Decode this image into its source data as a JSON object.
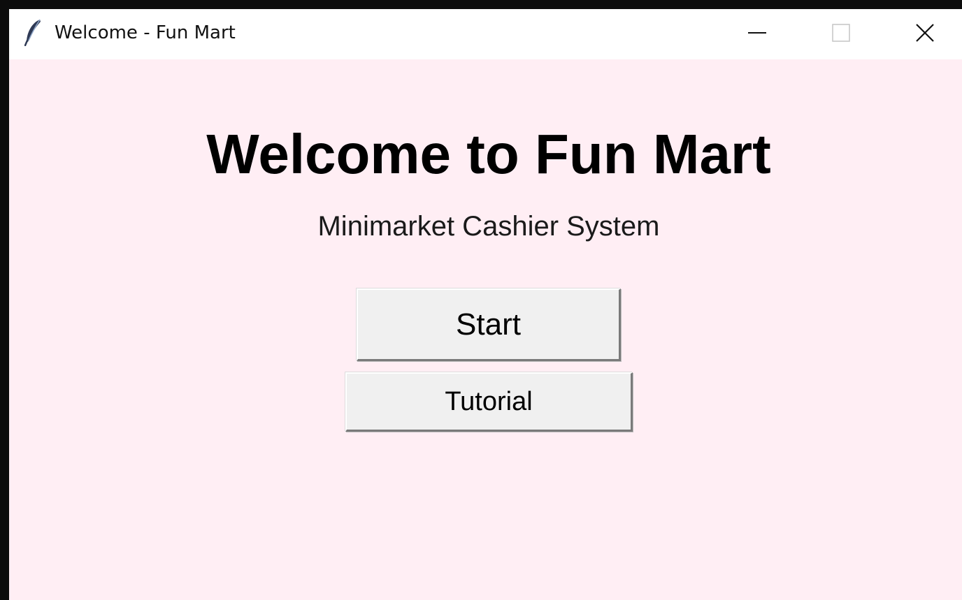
{
  "window": {
    "title": "Welcome - Fun Mart",
    "icon": "feather-icon",
    "controls": {
      "minimize": "minimize-icon",
      "maximize": "maximize-icon",
      "close": "close-icon"
    }
  },
  "main": {
    "heading": "Welcome to Fun Mart",
    "subtitle": "Minimarket Cashier System",
    "start_label": "Start",
    "tutorial_label": "Tutorial"
  },
  "colors": {
    "background": "#ffeef4",
    "titlebar": "#ffffff",
    "button_face": "#f0f0f0",
    "text": "#000000"
  }
}
